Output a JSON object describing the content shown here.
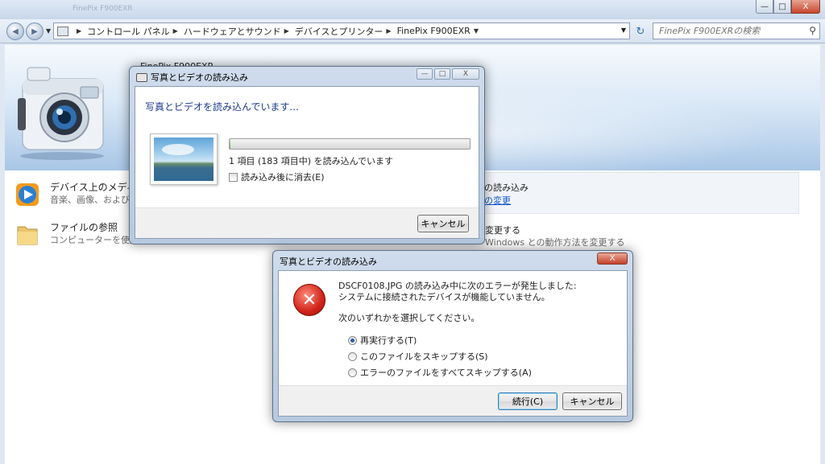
{
  "titlebar": {
    "ghost_text": "FinePix F900EXR",
    "minimize": "—",
    "maximize": "□",
    "close": "X"
  },
  "address": {
    "nav_back": "◀",
    "nav_forward": "▶",
    "breadcrumbs": [
      "コントロール パネル",
      "ハードウェアとサウンド",
      "デバイスとプリンター",
      "FinePix F900EXR"
    ],
    "refresh": "↻"
  },
  "search": {
    "placeholder": "FinePix F900EXRの検索"
  },
  "device": {
    "name": "FinePix F900EXR"
  },
  "tasks": [
    {
      "title": "デバイス上のメディア",
      "subtitle": "音楽、画像、およびビ"
    },
    {
      "title": "ファイルの参照",
      "subtitle": "コンピューターを使用"
    }
  ],
  "right_tasks": [
    {
      "title": "の読み込み",
      "link": "の変更"
    },
    {
      "title": "変更する",
      "subtitle": "Windows との動作方法を変更する"
    }
  ],
  "import_dialog": {
    "title": "写真とビデオの読み込み",
    "heading": "写真とビデオを読み込んでいます...",
    "progress_fraction": 0.005,
    "status": "1 項目 (183 項目中) を読み込んでいます",
    "delete_after_label": "読み込み後に消去(E)",
    "cancel_label": "キャンセル",
    "caption_min": "—",
    "caption_max": "□",
    "caption_close": "X"
  },
  "error_dialog": {
    "title": "写真とビデオの読み込み",
    "close": "X",
    "error_glyph": "✕",
    "message_line1": "DSCF0108.JPG の読み込み中に次のエラーが発生しました:",
    "message_line2": "システムに接続されたデバイスが機能していません。",
    "prompt": "次のいずれかを選択してください。",
    "options": [
      "再実行する(T)",
      "このファイルをスキップする(S)",
      "エラーのファイルをすべてスキップする(A)"
    ],
    "selected_option": 0,
    "continue_label": "続行(C)",
    "cancel_label": "キャンセル"
  }
}
